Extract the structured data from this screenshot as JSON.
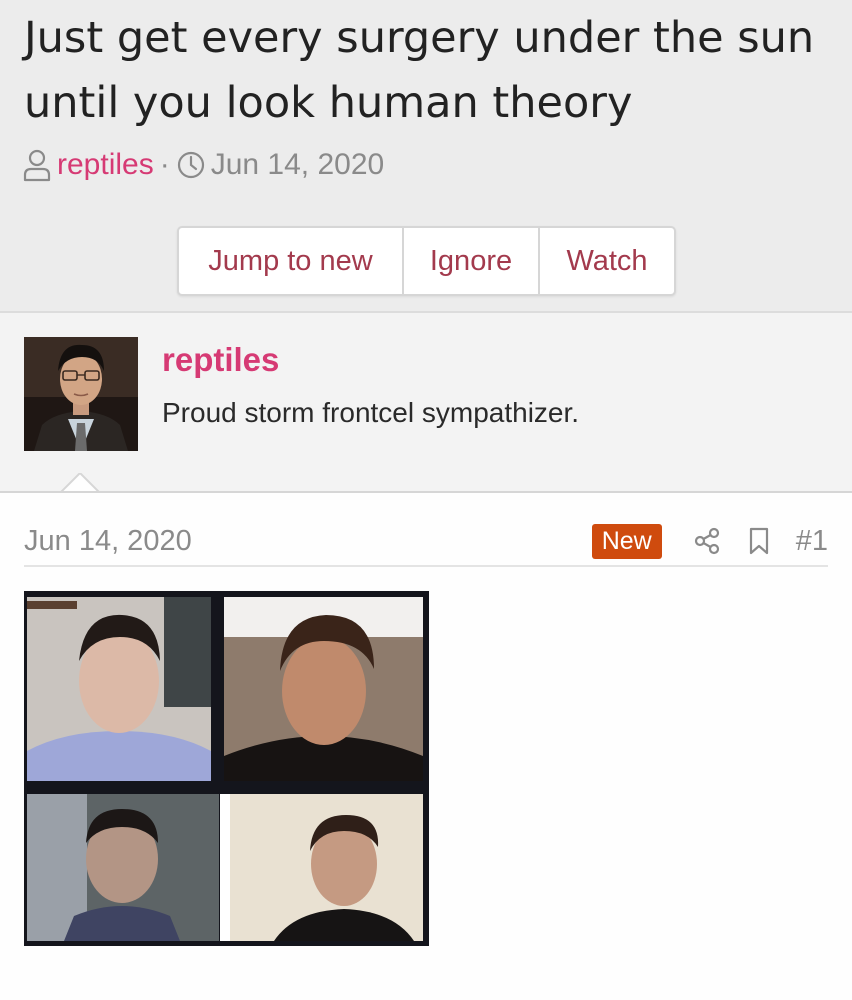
{
  "thread": {
    "title": "Just get every surgery under the sun until you look human theory",
    "author": "reptiles",
    "separator": "·",
    "date": "Jun 14, 2020",
    "icons": {
      "author": "user-icon",
      "date": "clock-icon"
    }
  },
  "actions": {
    "jump_to_new": "Jump to new",
    "ignore": "Ignore",
    "watch": "Watch"
  },
  "author_block": {
    "name": "reptiles",
    "user_title": "Proud storm frontcel sympathizer."
  },
  "post": {
    "date": "Jun 14, 2020",
    "badge": "New",
    "number": "#1",
    "icons": [
      "share-icon",
      "bookmark-icon"
    ]
  },
  "colors": {
    "author_link": "#d63a74",
    "button_text": "#a33a4d",
    "new_badge": "#cf4b0e",
    "header_bg": "#ececec"
  }
}
